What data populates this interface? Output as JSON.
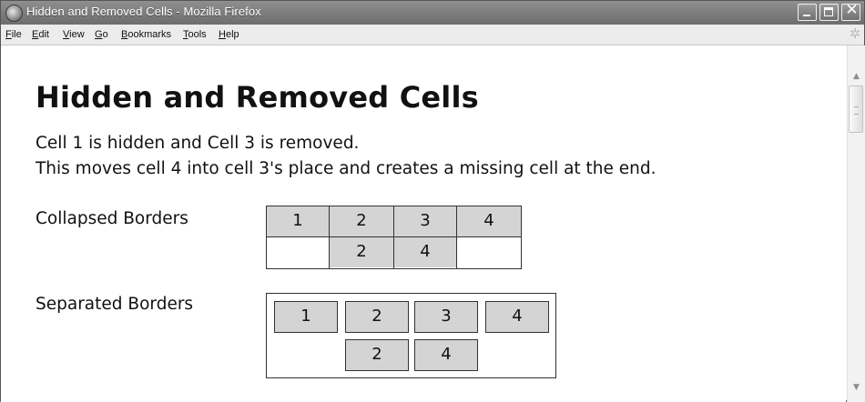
{
  "window": {
    "title": "Hidden and Removed Cells - Mozilla Firefox",
    "controls": [
      "minimize",
      "maximize",
      "close"
    ]
  },
  "menu": [
    {
      "label": "File",
      "accel": "F",
      "rest": "ile"
    },
    {
      "label": "Edit",
      "accel": "E",
      "rest": "dit"
    },
    {
      "label": "View",
      "accel": "V",
      "rest": "iew"
    },
    {
      "label": "Go",
      "accel": "G",
      "rest": "o"
    },
    {
      "label": "Bookmarks",
      "accel": "B",
      "rest": "ookmarks"
    },
    {
      "label": "Tools",
      "accel": "T",
      "rest": "ools"
    },
    {
      "label": "Help",
      "accel": "H",
      "rest": "elp"
    }
  ],
  "page": {
    "heading": "Hidden and Removed Cells",
    "line1": "Cell 1 is hidden and Cell 3 is removed.",
    "line2": "This moves cell 4 into cell 3's place and creates a missing cell at the end.",
    "collapsed_label": "Collapsed Borders",
    "separated_label": "Separated Borders"
  },
  "collapsed_table": {
    "row1": [
      "1",
      "2",
      "3",
      "4"
    ],
    "row2": [
      "",
      "2",
      "4",
      ""
    ]
  },
  "separated_table": {
    "row1": [
      "1",
      "2",
      "3",
      "4"
    ],
    "row2": [
      "2",
      "4"
    ]
  },
  "colors": {
    "cell_background": "#d4d4d4",
    "border": "#333333"
  }
}
